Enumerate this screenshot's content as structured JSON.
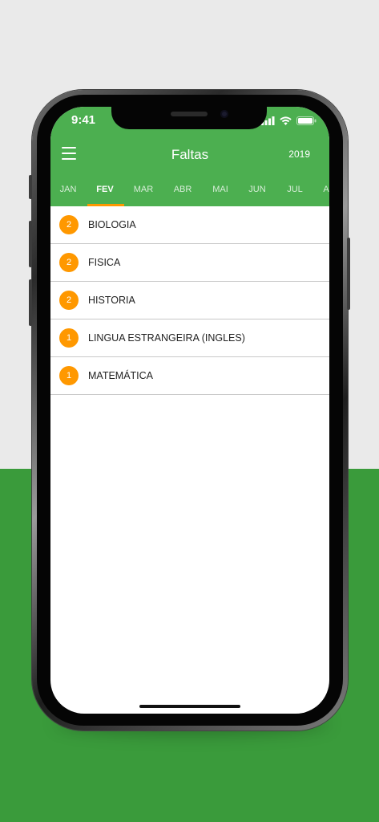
{
  "status_bar": {
    "time": "9:41",
    "icons": [
      "signal-icon",
      "wifi-icon",
      "battery-icon"
    ]
  },
  "app_bar": {
    "menu_icon": "hamburger-menu-icon",
    "title": "Faltas",
    "year": "2019",
    "color": "#4caf50"
  },
  "tabs": {
    "items": [
      "JAN",
      "FEV",
      "MAR",
      "ABR",
      "MAI",
      "JUN",
      "JUL",
      "A"
    ],
    "active": "FEV",
    "indicator_color": "#ff9800"
  },
  "absences": [
    {
      "count": "2",
      "subject": "BIOLOGIA"
    },
    {
      "count": "2",
      "subject": "FISICA"
    },
    {
      "count": "2",
      "subject": "HISTORIA"
    },
    {
      "count": "1",
      "subject": "LINGUA ESTRANGEIRA (INGLES)"
    },
    {
      "count": "1",
      "subject": "MATEMÁTICA"
    }
  ],
  "colors": {
    "badge": "#ff9800",
    "background_top": "#eaeaea",
    "background_bottom": "#3a9b3b"
  }
}
